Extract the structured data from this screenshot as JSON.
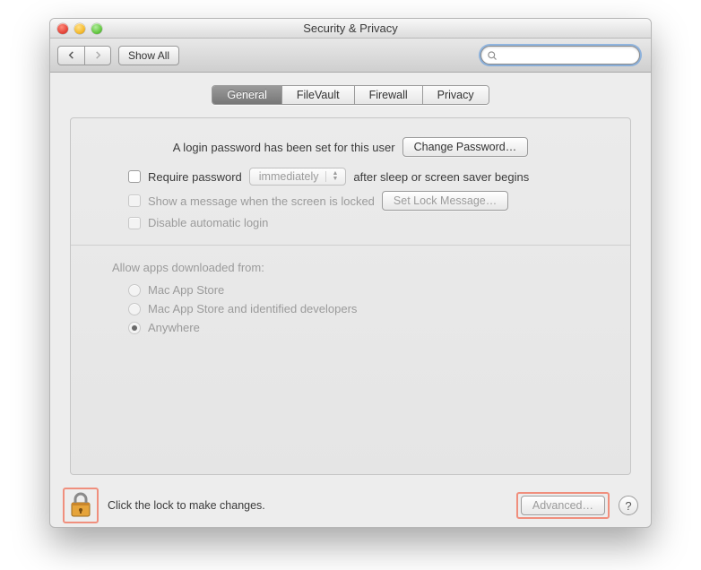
{
  "window": {
    "title": "Security & Privacy"
  },
  "toolbar": {
    "show_all_label": "Show All",
    "search_value": "",
    "search_placeholder": ""
  },
  "tabs": {
    "general": "General",
    "filevault": "FileVault",
    "firewall": "Firewall",
    "privacy": "Privacy",
    "active": "general"
  },
  "general": {
    "login_set_text": "A login password has been set for this user",
    "change_password_label": "Change Password…",
    "require_password_label": "Require password",
    "require_password_popup": "immediately",
    "require_password_suffix": "after sleep or screen saver begins",
    "show_message_label": "Show a message when the screen is locked",
    "set_lock_message_label": "Set Lock Message…",
    "disable_auto_login_label": "Disable automatic login",
    "allow_apps_header": "Allow apps downloaded from:",
    "radio_mac_app_store": "Mac App Store",
    "radio_identified": "Mac App Store and identified developers",
    "radio_anywhere": "Anywhere",
    "selected_source": "anywhere"
  },
  "footer": {
    "lock_text": "Click the lock to make changes.",
    "advanced_label": "Advanced…"
  }
}
